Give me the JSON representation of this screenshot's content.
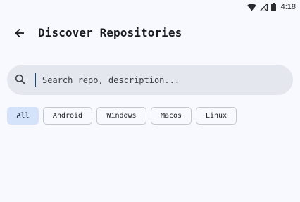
{
  "status_bar": {
    "time": "4:18",
    "icons": [
      "wifi-icon",
      "no-signal-icon",
      "battery-icon"
    ]
  },
  "app_bar": {
    "title": "Discover Repositories",
    "back_icon": "arrow-back-icon"
  },
  "search": {
    "placeholder": "Search repo, description...",
    "value": "",
    "icon": "search-icon"
  },
  "filters": {
    "selected": "All",
    "chips": [
      "All",
      "Android",
      "Windows",
      "Macos",
      "Linux"
    ]
  },
  "colors": {
    "background": "#f8f9ff",
    "search_background": "#e4e7ee",
    "chip_selected_background": "#d4e3fa",
    "chip_border": "#c4c7cf",
    "caret": "#23456b"
  }
}
